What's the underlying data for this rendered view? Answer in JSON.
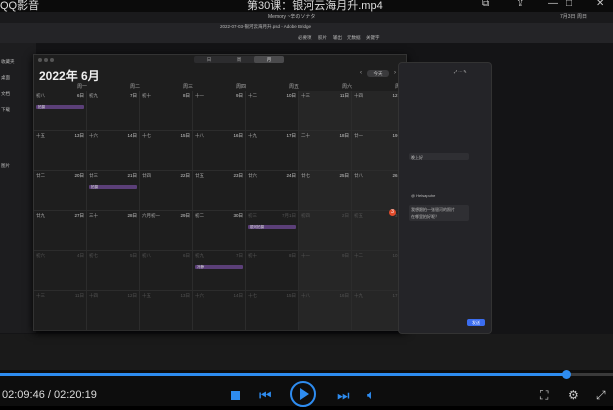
{
  "player": {
    "app_title": "QQ影音",
    "video_title": "第30课：银河云海月升.mp4",
    "current_time": "02:09:46",
    "total_time": "02:20:19",
    "time_separator": " / ",
    "progress": 0.924
  },
  "mac_menubar": {
    "left": "Memory ~辛のソナタ",
    "right": "7月3日 周日"
  },
  "app_window_title": "2022-07-03-银河云海月升.psd - Adobe Bridge",
  "toolbar": {
    "items": [
      "必要项",
      "胶片",
      "输出",
      "元数据",
      "关键字"
    ]
  },
  "left_panel": {
    "items": [
      "收藏夹",
      "桌面",
      "文档",
      "下载",
      "图片"
    ]
  },
  "calendar": {
    "views": [
      "日",
      "周",
      "月"
    ],
    "active_view": "月",
    "month_title": "2022年 6月",
    "today_button": "今天",
    "weekdays": [
      "周一",
      "周二",
      "周三",
      "周四",
      "周五",
      "周六",
      "周日"
    ],
    "weeks": [
      [
        {
          "lunar": "初八",
          "day": "6日"
        },
        {
          "lunar": "初九",
          "day": "7日"
        },
        {
          "lunar": "初十",
          "day": "8日"
        },
        {
          "lunar": "十一",
          "day": "9日"
        },
        {
          "lunar": "十二",
          "day": "10日"
        },
        {
          "lunar": "十三",
          "day": "11日"
        },
        {
          "lunar": "十四",
          "day": "12日"
        }
      ],
      [
        {
          "lunar": "十五",
          "day": "13日"
        },
        {
          "lunar": "十六",
          "day": "14日"
        },
        {
          "lunar": "十七",
          "day": "15日"
        },
        {
          "lunar": "十八",
          "day": "16日"
        },
        {
          "lunar": "十九",
          "day": "17日"
        },
        {
          "lunar": "二十",
          "day": "18日"
        },
        {
          "lunar": "廿一",
          "day": "19日"
        }
      ],
      [
        {
          "lunar": "廿二",
          "day": "20日"
        },
        {
          "lunar": "廿三",
          "day": "21日"
        },
        {
          "lunar": "廿四",
          "day": "22日"
        },
        {
          "lunar": "廿五",
          "day": "23日"
        },
        {
          "lunar": "廿六",
          "day": "24日"
        },
        {
          "lunar": "廿七",
          "day": "25日"
        },
        {
          "lunar": "廿八",
          "day": "26日"
        }
      ],
      [
        {
          "lunar": "廿九",
          "day": "27日"
        },
        {
          "lunar": "三十",
          "day": "28日"
        },
        {
          "lunar": "六月初一",
          "day": "29日"
        },
        {
          "lunar": "初二",
          "day": "30日"
        },
        {
          "lunar": "初三",
          "day": "7月1日",
          "dim": true
        },
        {
          "lunar": "初四",
          "day": "2日",
          "dim": true
        },
        {
          "lunar": "初五",
          "day": "3日",
          "dim": true
        }
      ],
      [
        {
          "lunar": "初六",
          "day": "4日",
          "dim": true
        },
        {
          "lunar": "初七",
          "day": "5日",
          "dim": true
        },
        {
          "lunar": "初八",
          "day": "6日",
          "dim": true
        },
        {
          "lunar": "初九",
          "day": "7日",
          "dim": true
        },
        {
          "lunar": "初十",
          "day": "8日",
          "dim": true
        },
        {
          "lunar": "十一",
          "day": "9日",
          "dim": true
        },
        {
          "lunar": "十二",
          "day": "10日",
          "dim": true
        }
      ],
      [
        {
          "lunar": "十三",
          "day": "11日",
          "dim": true
        },
        {
          "lunar": "十四",
          "day": "12日",
          "dim": true
        },
        {
          "lunar": "十五",
          "day": "13日",
          "dim": true
        },
        {
          "lunar": "十六",
          "day": "14日",
          "dim": true
        },
        {
          "lunar": "十七",
          "day": "15日",
          "dim": true
        },
        {
          "lunar": "十八",
          "day": "16日",
          "dim": true
        },
        {
          "lunar": "十九",
          "day": "17日",
          "dim": true
        }
      ]
    ],
    "events": [
      {
        "week": 0,
        "col": 0,
        "label": "拍摄"
      },
      {
        "week": 2,
        "col": 1,
        "label": "拍摄"
      },
      {
        "week": 3,
        "col": 4,
        "label": "银河拍摄"
      },
      {
        "week": 4,
        "col": 3,
        "label": "冷静"
      }
    ]
  },
  "chat": {
    "header": "",
    "lines": [
      "晚上好",
      "@ Helsapuhe",
      "我想跟拍一张银河的照片",
      "在哪里拍好呢？"
    ],
    "send_label": "发送"
  },
  "notification_count": "3",
  "colors": {
    "accent": "#2e8cf0",
    "event": "#5b3f78",
    "badge": "#e04a2a"
  }
}
